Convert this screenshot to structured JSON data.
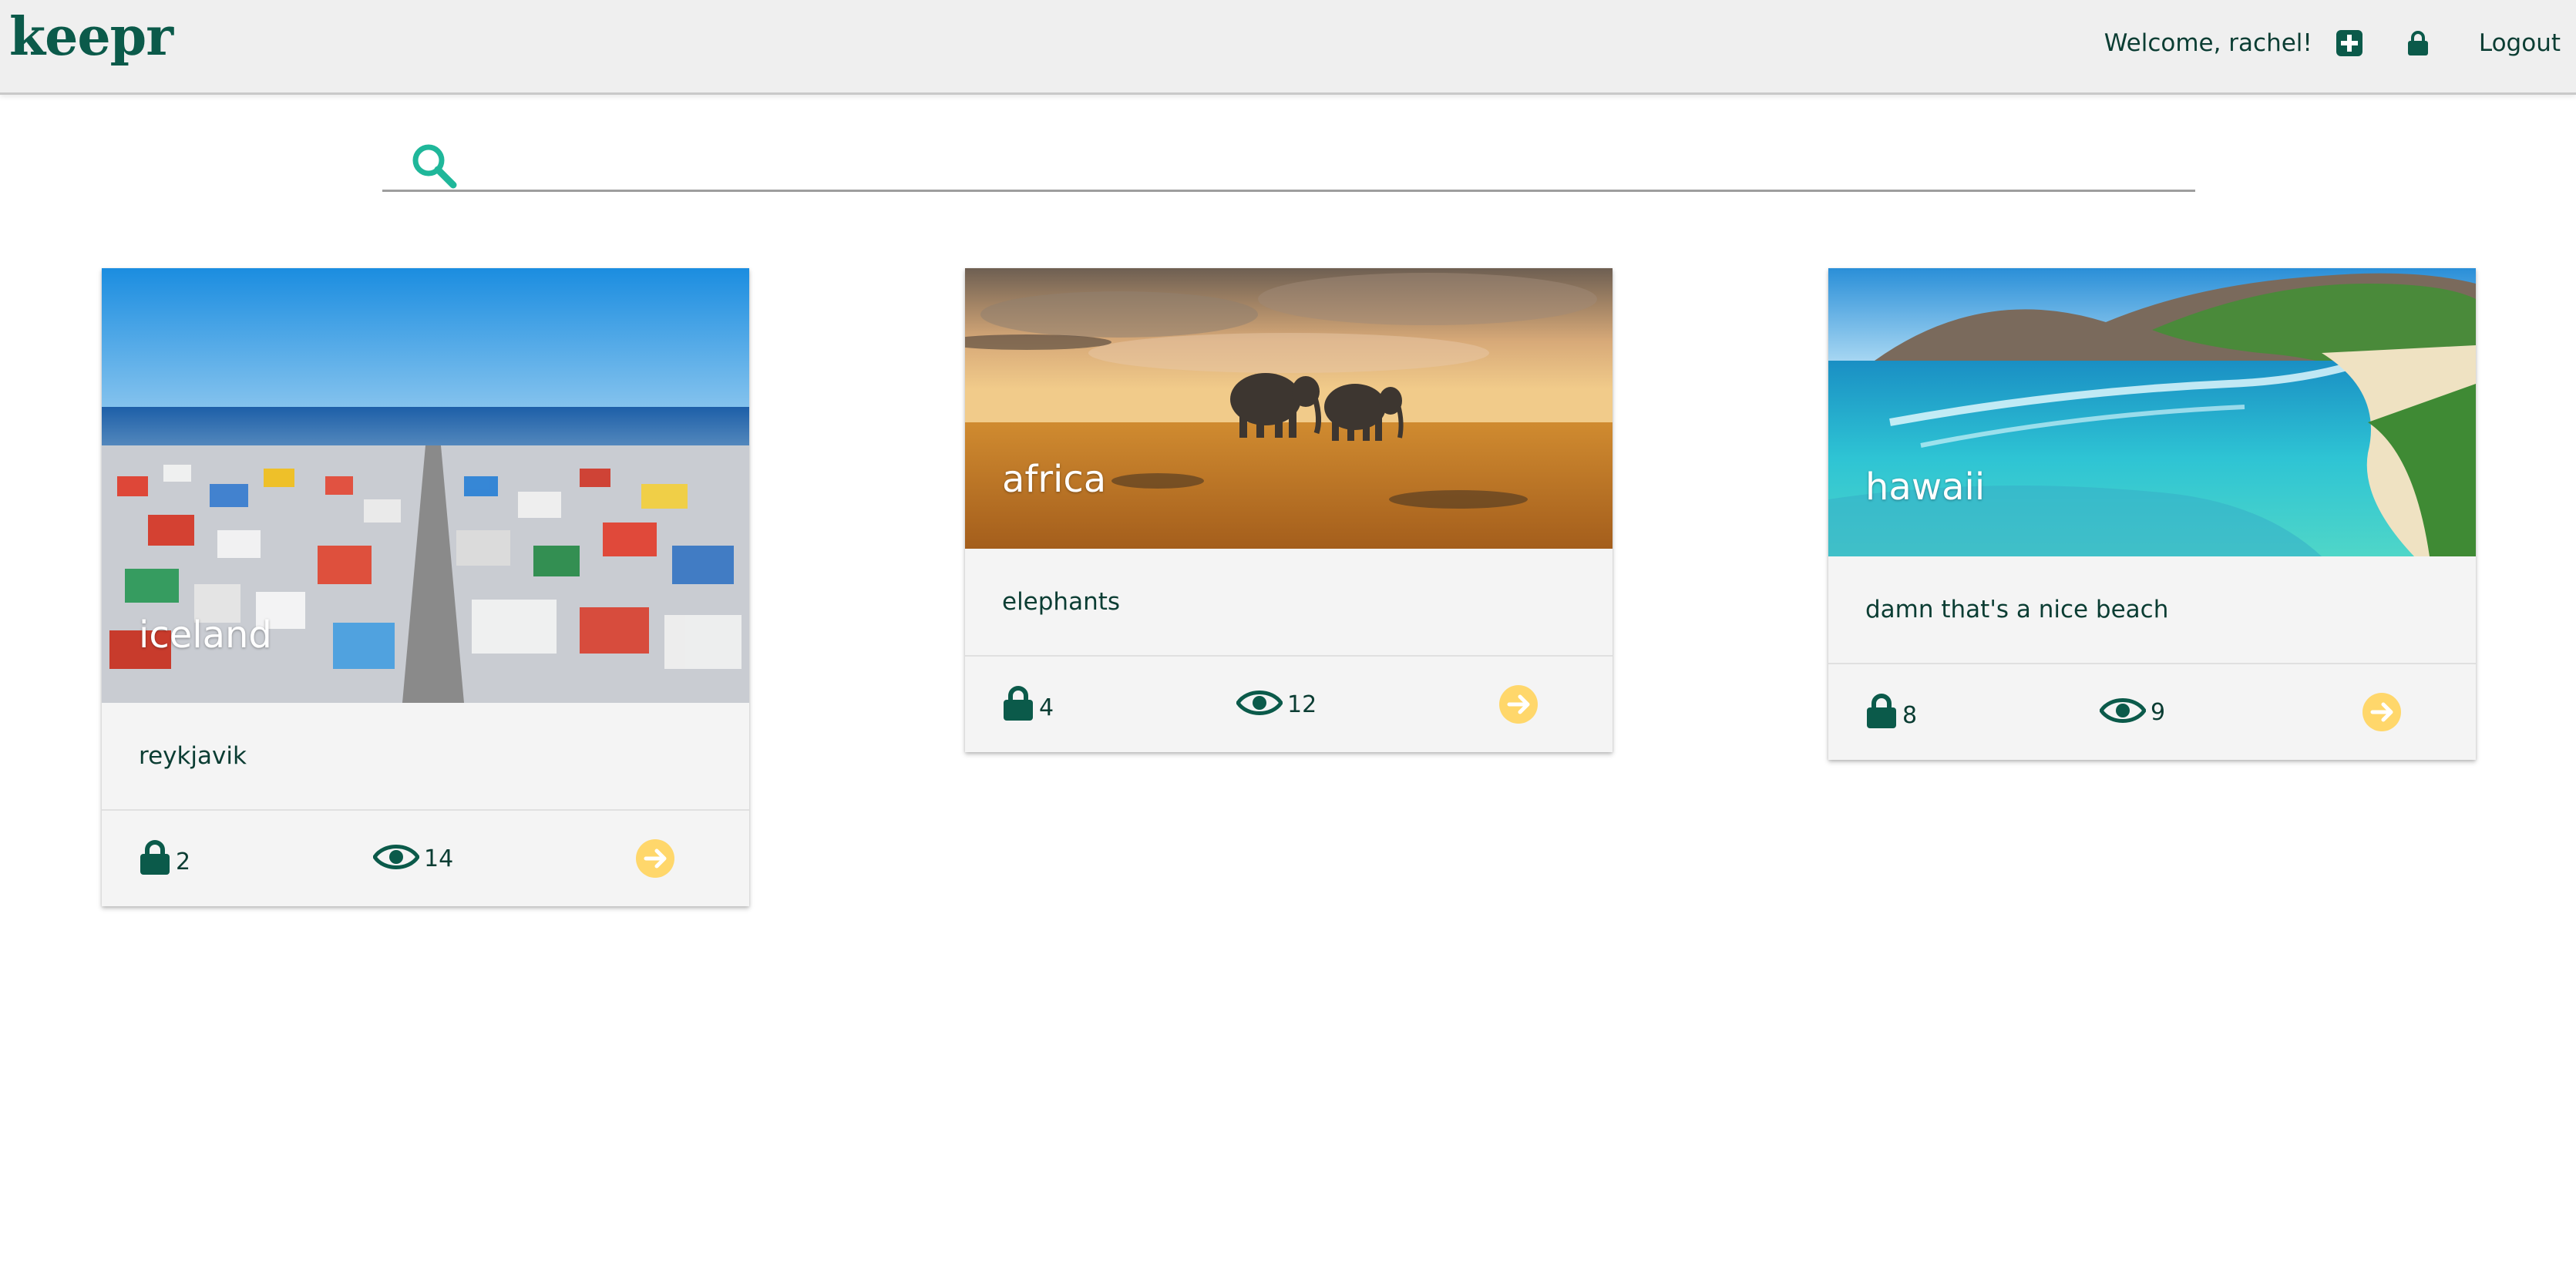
{
  "header": {
    "brand": "keepr",
    "welcome": "Welcome, rachel!",
    "icons": [
      "plus-square-icon",
      "lock-icon"
    ],
    "logout": "Logout"
  },
  "search": {
    "placeholder": "",
    "value": ""
  },
  "colors": {
    "brand_green": "#0b5a4a",
    "search_teal": "#1fb79a",
    "arrow_yellow": "#ffd76b",
    "card_bg": "#f4f4f4"
  },
  "cards": [
    {
      "title": "iceland",
      "description": "reykjavik",
      "keeps": "2",
      "views": "14"
    },
    {
      "title": "africa",
      "description": "elephants",
      "keeps": "4",
      "views": "12"
    },
    {
      "title": "hawaii",
      "description": "damn that's a nice beach",
      "keeps": "8",
      "views": "9"
    }
  ]
}
